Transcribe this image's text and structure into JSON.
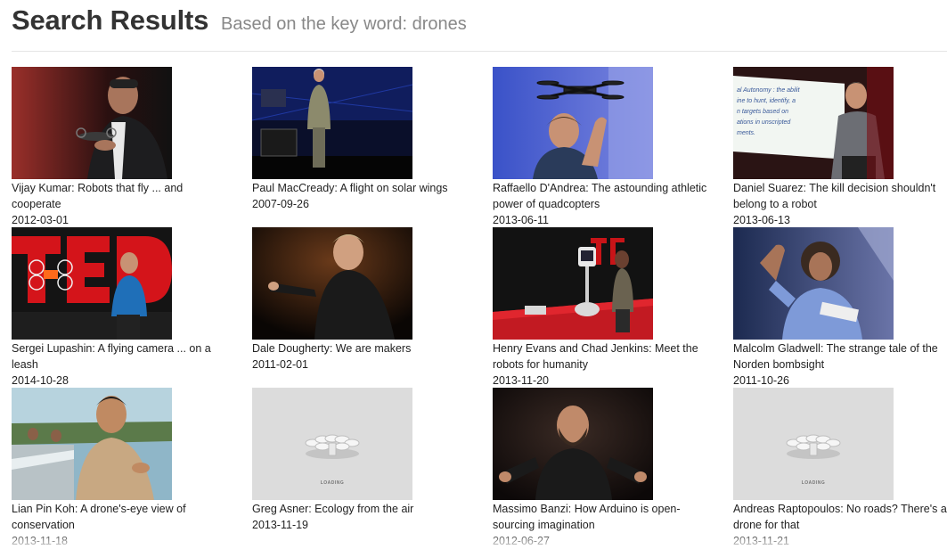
{
  "header": {
    "title": "Search Results",
    "subtitle": "Based on the key word: drones"
  },
  "loading_label": "LOADING",
  "results": [
    {
      "title": "Vijay Kumar: Robots that fly ... and cooperate",
      "date": "2012-03-01",
      "thumb": "speaker-with-drone"
    },
    {
      "title": "Paul MacCready: A flight on solar wings",
      "date": "2007-09-26",
      "thumb": "speaker-on-stage"
    },
    {
      "title": "Raffaello D'Andrea: The astounding athletic power of quadcopters",
      "date": "2013-06-11",
      "thumb": "quadcopter-hover"
    },
    {
      "title": "Daniel Suarez: The kill decision shouldn't belong to a robot",
      "date": "2013-06-13",
      "thumb": "speaker-with-slide"
    },
    {
      "title": "Sergei Lupashin: A flying camera ... on a leash",
      "date": "2014-10-28",
      "thumb": "ted-letters-drone"
    },
    {
      "title": "Dale Dougherty: We are makers",
      "date": "2011-02-01",
      "thumb": "speaker-dark"
    },
    {
      "title": "Henry Evans and Chad Jenkins: Meet the robots for humanity",
      "date": "2013-11-20",
      "thumb": "robot-red-stage"
    },
    {
      "title": "Malcolm Gladwell: The strange tale of the Norden bombsight",
      "date": "2011-10-26",
      "thumb": "speaker-blue-bg"
    },
    {
      "title": "Lian Pin Koh: A drone's-eye view of conservation",
      "date": "2013-11-18",
      "thumb": "speaker-with-plane"
    },
    {
      "title": "Greg Asner: Ecology from the air",
      "date": "2013-11-19",
      "thumb": "loading"
    },
    {
      "title": "Massimo Banzi: How Arduino is open-sourcing imagination",
      "date": "2012-06-27",
      "thumb": "speaker-bearded"
    },
    {
      "title": "Andreas Raptopoulos: No roads? There's a drone for that",
      "date": "2013-11-21",
      "thumb": "loading"
    }
  ]
}
